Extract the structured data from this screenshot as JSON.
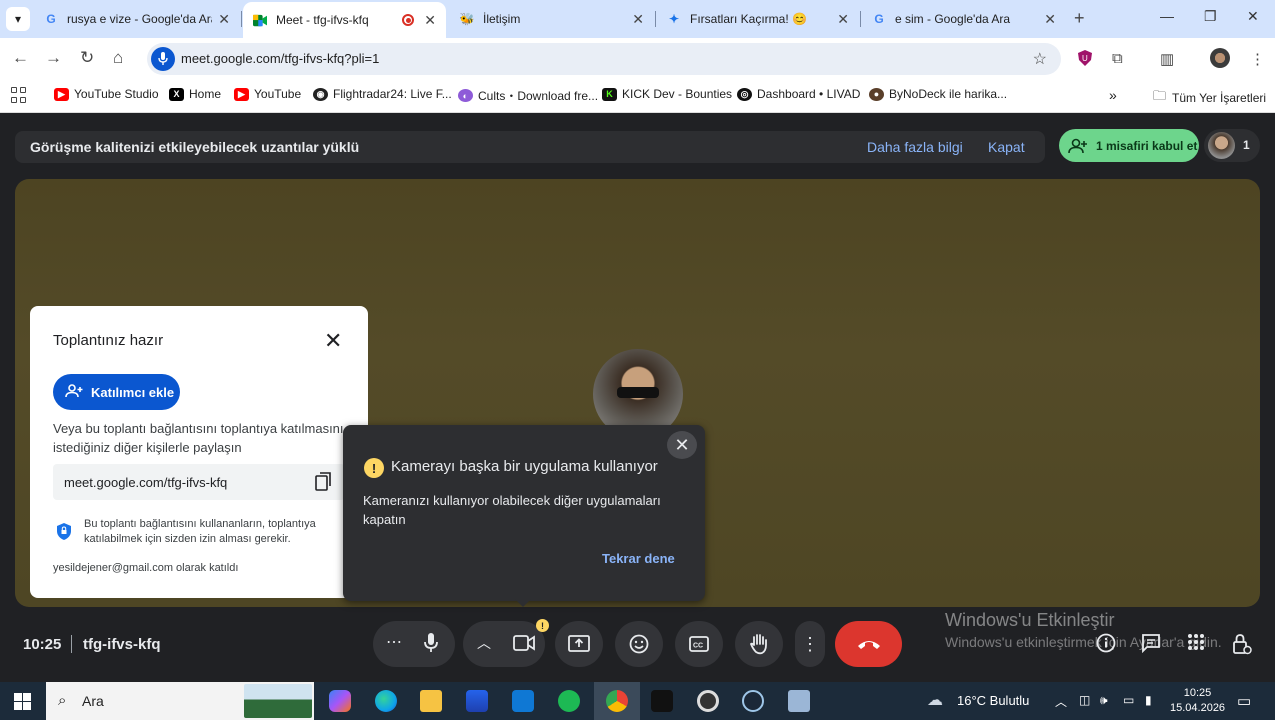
{
  "browser": {
    "tabs": [
      {
        "title": "rusya e vize - Google'da Ara"
      },
      {
        "title": "Meet - tfg-ifvs-kfq"
      },
      {
        "title": "İletişim"
      },
      {
        "title": "Fırsatları Kaçırma! 😊"
      },
      {
        "title": "e sim - Google'da Ara"
      }
    ],
    "url": "meet.google.com/tfg-ifvs-kfq?pli=1",
    "bookmarks": [
      {
        "label": "YouTube Studio"
      },
      {
        "label": "Home"
      },
      {
        "label": "YouTube"
      },
      {
        "label": "Flightradar24: Live F..."
      },
      {
        "label": "Cults・Download fre..."
      },
      {
        "label": "KICK Dev - Bounties"
      },
      {
        "label": "Dashboard • LIVAD"
      },
      {
        "label": "ByNoDeck ile harika..."
      }
    ],
    "all_bookmarks": "Tüm Yer İşaretleri"
  },
  "meet": {
    "banner": {
      "message": "Görüşme kalitenizi etkileyebilecek uzantılar yüklü",
      "learn_more": "Daha fazla bilgi",
      "dismiss": "Kapat"
    },
    "admit_button": "1 misafiri kabul et",
    "participant_count": "1",
    "ready_panel": {
      "title": "Toplantınız hazır",
      "add_button": "Katılımcı ekle",
      "description": "Veya bu toplantı bağlantısını toplantıya katılmasını istediğiniz diğer kişilerle paylaşın",
      "link": "meet.google.com/tfg-ifvs-kfq",
      "note": "Bu toplantı bağlantısını kullananların, toplantıya katılabilmek için sizden izin alması gerekir.",
      "joined_as": "yesildejener@gmail.com olarak katıldı"
    },
    "camera_popup": {
      "heading": "Kamerayı başka bir uygulama kullanıyor",
      "body": "Kameranızı kullanıyor olabilecek diğer uygulamaları kapatın",
      "retry": "Tekrar dene"
    },
    "time": "10:25",
    "meeting_code": "tfg-ifvs-kfq",
    "watermark": {
      "title": "Windows'u Etkinleştir",
      "subtitle": "Windows'u etkinleştirmek için Ayarlar'a gidin."
    }
  },
  "taskbar": {
    "search_placeholder": "Ara",
    "weather": "16°C  Bulutlu",
    "clock_time": "10:25",
    "clock_date": "15.04.2026"
  },
  "colors": {
    "accent": "#0b57d0",
    "admit_green": "#6dd58c",
    "end_call_red": "#dc362e",
    "link_blue": "#8ab4f8",
    "warning_yellow": "#fdd663"
  }
}
